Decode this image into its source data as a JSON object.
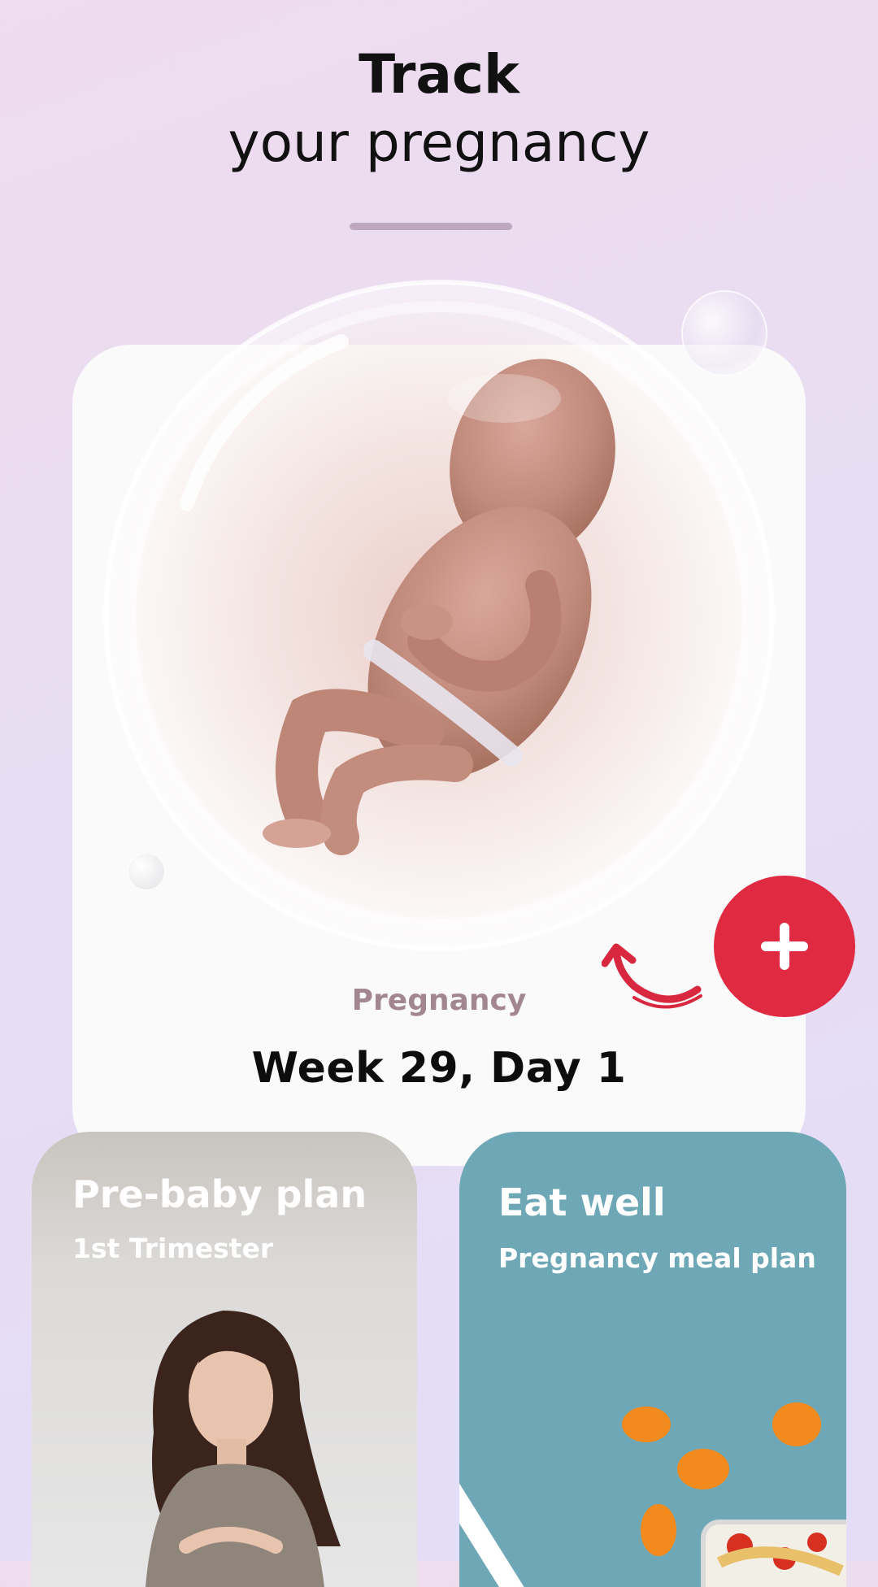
{
  "header": {
    "title_bold": "Track",
    "title_light": "your pregnancy"
  },
  "pregnancy_card": {
    "label": "Pregnancy",
    "week_day": "Week 29, Day 1"
  },
  "tiles": [
    {
      "title": "Pre-baby plan",
      "subtitle": "1st Trimester"
    },
    {
      "title": "Eat well",
      "subtitle": "Pregnancy meal plan"
    }
  ],
  "icons": {
    "add": "plus-icon",
    "hint_arrow": "curved-arrow-icon",
    "fetus": "fetus-illustration",
    "woman": "pregnant-woman-photo",
    "food": "meal-photo"
  },
  "colors": {
    "accent": "#e02a42",
    "label": "#a28790",
    "tile_right_bg": "#6ea7b5"
  }
}
